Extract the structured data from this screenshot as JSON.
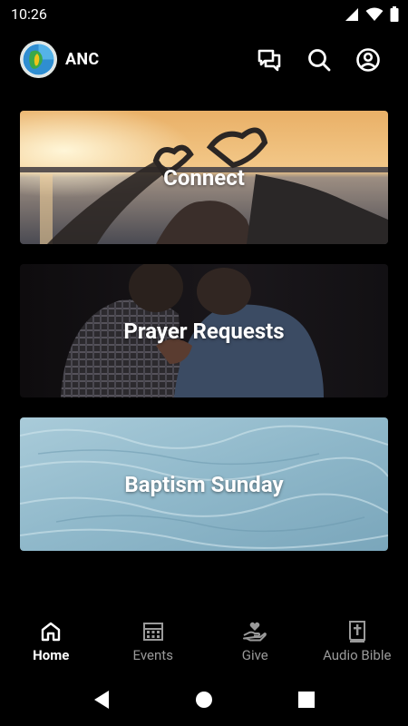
{
  "status_bar": {
    "time": "10:26"
  },
  "header": {
    "app_name": "ANC"
  },
  "cards": [
    {
      "title": "Connect"
    },
    {
      "title": "Prayer Requests"
    },
    {
      "title": "Baptism Sunday"
    }
  ],
  "tabs": [
    {
      "label": "Home",
      "icon": "home-icon",
      "active": true
    },
    {
      "label": "Events",
      "icon": "calendar-icon",
      "active": false
    },
    {
      "label": "Give",
      "icon": "give-icon",
      "active": false
    },
    {
      "label": "Audio Bible",
      "icon": "bible-icon",
      "active": false
    }
  ],
  "colors": {
    "background": "#000000",
    "active_tab": "#ffffff",
    "inactive_tab": "#9a9a9a"
  }
}
